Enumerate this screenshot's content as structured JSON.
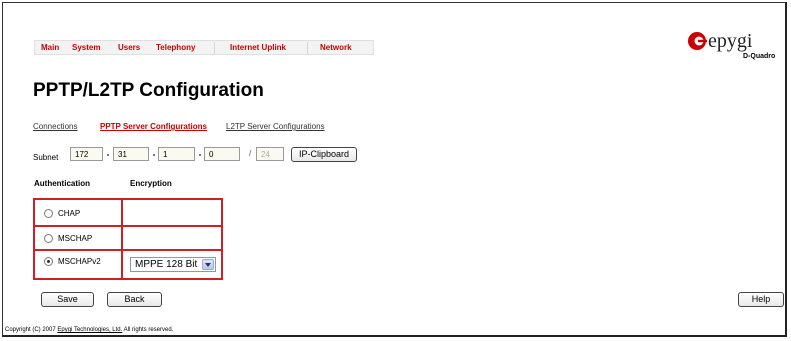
{
  "menu": {
    "items": [
      "Main",
      "System",
      "Users",
      "Telephony",
      "Internet Uplink",
      "Network"
    ]
  },
  "logo": {
    "brand": "epygi",
    "subtitle": "D-Quadro",
    "color": "#cc0000"
  },
  "page": {
    "title": "PPTP/L2TP Configuration"
  },
  "subtabs": {
    "connections": "Connections",
    "pptp": "PPTP Server Configurations",
    "l2tp": "L2TP Server Configurations",
    "active": "PPTP Server Configurations"
  },
  "subnet": {
    "label": "Subnet",
    "octets": [
      "172",
      "31",
      "1",
      "0"
    ],
    "slash": "/",
    "mask": "24",
    "clipboard_button": "IP-Clipboard"
  },
  "table": {
    "auth_header": "Authentication",
    "enc_header": "Encryption",
    "rows": [
      {
        "label": "CHAP",
        "checked": false
      },
      {
        "label": "MSCHAP",
        "checked": false
      },
      {
        "label": "MSCHAPv2",
        "checked": true
      }
    ],
    "encryption_value": "MPPE 128 Bit"
  },
  "buttons": {
    "save": "Save",
    "back": "Back",
    "help": "Help"
  },
  "footer": {
    "prefix": "Copyright (C) 2007",
    "link": "Epygi Technologies, Ltd.",
    "suffix": "All rights reserved."
  },
  "icons": {
    "logo": "epygi-logo-icon",
    "dropdown": "chevron-down-icon",
    "radio": "radio-icon"
  }
}
